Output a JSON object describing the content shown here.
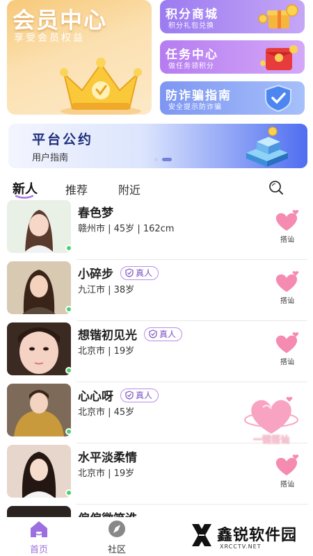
{
  "vip": {
    "title": "会员中心",
    "subtitle": "享受会员权益"
  },
  "feature_cards": [
    {
      "title": "积分商城",
      "subtitle": "积分礼包兑换"
    },
    {
      "title": "任务中心",
      "subtitle": "做任务领积分"
    },
    {
      "title": "防诈骗指南",
      "subtitle": "安全提示防诈骗"
    }
  ],
  "banner": {
    "title": "平台公约",
    "subtitle": "用户指南"
  },
  "tabs": [
    {
      "label": "新人",
      "active": true
    },
    {
      "label": "推荐",
      "active": false
    },
    {
      "label": "附近",
      "active": false
    }
  ],
  "users": [
    {
      "name": "春色梦",
      "info": "赣州市 | 45岁 | 162cm",
      "verified": false,
      "online": true
    },
    {
      "name": "小碎步",
      "info": "九江市 | 38岁",
      "verified": true,
      "online": true
    },
    {
      "name": "想锴初见光",
      "info": "北京市 | 19岁",
      "verified": true,
      "online": true
    },
    {
      "name": "心心呀",
      "info": "北京市 | 45岁",
      "verified": true,
      "online": true
    },
    {
      "name": "水平淡柔情",
      "info": "北京市 | 19岁",
      "verified": false,
      "online": true
    },
    {
      "name": "偏偏微笑谁",
      "info": "",
      "verified": false,
      "online": false
    }
  ],
  "verified_label": "真人",
  "chat_label": "搭讪",
  "one_click_chat": "一键搭讪",
  "nav": {
    "home": "首页",
    "community": "社区"
  },
  "watermark": {
    "name": "鑫锐软件园",
    "url": "XRCCTV.NET"
  },
  "colors": {
    "accent": "#9c6fe0",
    "online": "#4dcf6a",
    "heart": "#f58bb0"
  }
}
